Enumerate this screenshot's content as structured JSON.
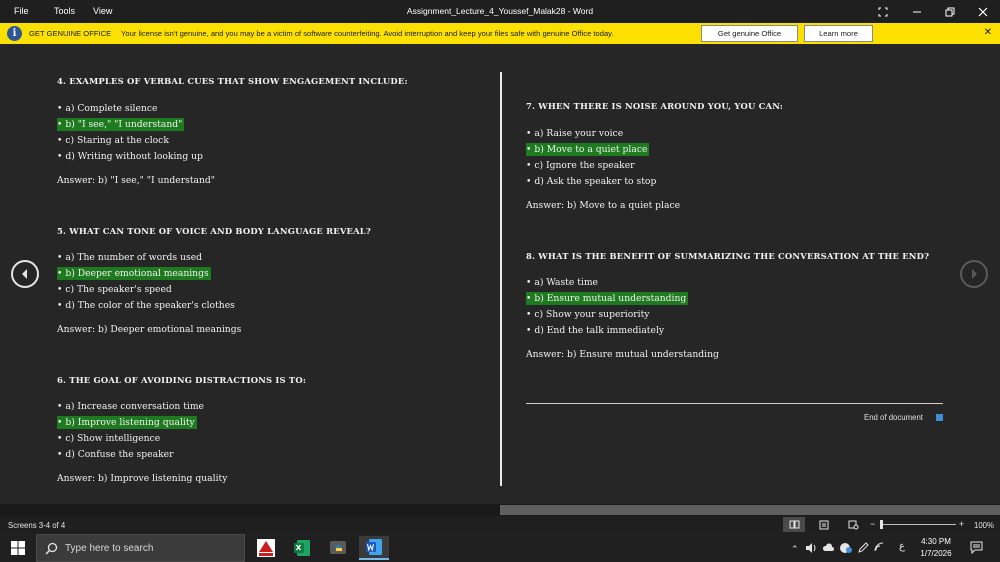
{
  "titlebar": {
    "menus": [
      "File",
      "Tools",
      "View"
    ],
    "title": "Assignment_Lecture_4_Youssef_Malak28  -  Word"
  },
  "notification": {
    "title": "GET GENUINE OFFICE",
    "message": "Your license isn't genuine, and you may be a victim of software counterfeiting. Avoid interruption and keep your files safe with genuine Office today.",
    "primary_button": "Get genuine Office",
    "secondary_button": "Learn more"
  },
  "left_page": {
    "questions": [
      {
        "heading": "4. Examples of verbal cues that show engagement include:",
        "options": [
          {
            "text": "• a) Complete silence",
            "highlight": false
          },
          {
            "text": "• b) \"I see,\" \"I understand\"",
            "highlight": true
          },
          {
            "text": "• c) Staring at the clock",
            "highlight": false
          },
          {
            "text": "• d) Writing without looking up",
            "highlight": false
          }
        ],
        "answer": "Answer: b) \"I see,\" \"I understand\""
      },
      {
        "heading": "5. What can tone of voice and body language reveal?",
        "options": [
          {
            "text": "• a) The number of words used",
            "highlight": false
          },
          {
            "text": "• b) Deeper emotional meanings",
            "highlight": true
          },
          {
            "text": "• c) The speaker's speed",
            "highlight": false
          },
          {
            "text": "• d) The color of the speaker's clothes",
            "highlight": false
          }
        ],
        "answer": "Answer: b) Deeper emotional meanings"
      },
      {
        "heading": "6. The goal of avoiding distractions is to:",
        "options": [
          {
            "text": "• a) Increase conversation time",
            "highlight": false
          },
          {
            "text": "• b) Improve listening quality",
            "highlight": true
          },
          {
            "text": "• c) Show intelligence",
            "highlight": false
          },
          {
            "text": "• d) Confuse the speaker",
            "highlight": false
          }
        ],
        "answer": "Answer: b) Improve listening quality"
      }
    ]
  },
  "right_page": {
    "questions": [
      {
        "heading": "7. When there is noise around you, you can:",
        "options": [
          {
            "text": "• a) Raise your voice",
            "highlight": false
          },
          {
            "text": "• b) Move to a quiet place",
            "highlight": true
          },
          {
            "text": "• c) Ignore the speaker",
            "highlight": false
          },
          {
            "text": "• d) Ask the speaker to stop",
            "highlight": false
          }
        ],
        "answer": "Answer: b) Move to a quiet place"
      },
      {
        "heading": "8. What is the benefit of summarizing the conversation at the end?",
        "options": [
          {
            "text": "• a) Waste time",
            "highlight": false
          },
          {
            "text": "• b) Ensure mutual understanding",
            "highlight": true
          },
          {
            "text": "• c) Show your superiority",
            "highlight": false
          },
          {
            "text": "• d) End the talk immediately",
            "highlight": false
          }
        ],
        "answer": "Answer: b) Ensure mutual understanding"
      }
    ],
    "end_of_document": "End of document"
  },
  "statusbar": {
    "screens": "Screens 3-4 of 4",
    "zoom": "100%",
    "zoom_level": 0.0
  },
  "taskbar": {
    "search_placeholder": "Type here to search",
    "time": "4:30 PM",
    "date": "1/7/2026",
    "lang": "ع"
  },
  "colors": {
    "notification_bg": "#fce100",
    "highlight": "#1e7a1e",
    "page_bg": "#262626",
    "accent_blue": "#3f8fd6"
  }
}
